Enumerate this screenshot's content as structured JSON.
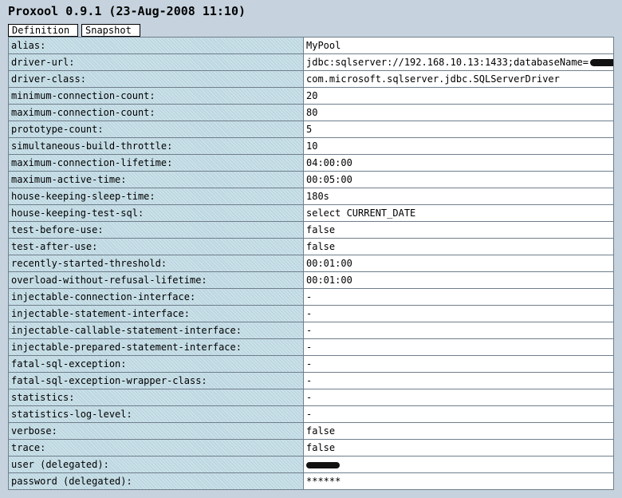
{
  "header": {
    "title": "Proxool 0.9.1 (23-Aug-2008 11:10)"
  },
  "tabs": [
    {
      "label": "Definition"
    },
    {
      "label": "Snapshot"
    }
  ],
  "properties": [
    {
      "name": "alias:",
      "value": "MyPool"
    },
    {
      "name": "driver-url:",
      "value": "jdbc:sqlserver://192.168.10.13:1433;databaseName="
    },
    {
      "name": "driver-class:",
      "value": "com.microsoft.sqlserver.jdbc.SQLServerDriver"
    },
    {
      "name": "minimum-connection-count:",
      "value": "20"
    },
    {
      "name": "maximum-connection-count:",
      "value": "80"
    },
    {
      "name": "prototype-count:",
      "value": "5"
    },
    {
      "name": "simultaneous-build-throttle:",
      "value": "10"
    },
    {
      "name": "maximum-connection-lifetime:",
      "value": "04:00:00"
    },
    {
      "name": "maximum-active-time:",
      "value": "00:05:00"
    },
    {
      "name": "house-keeping-sleep-time:",
      "value": "180s"
    },
    {
      "name": "house-keeping-test-sql:",
      "value": "select CURRENT_DATE"
    },
    {
      "name": "test-before-use:",
      "value": "false"
    },
    {
      "name": "test-after-use:",
      "value": "false"
    },
    {
      "name": "recently-started-threshold:",
      "value": "00:01:00"
    },
    {
      "name": "overload-without-refusal-lifetime:",
      "value": "00:01:00"
    },
    {
      "name": "injectable-connection-interface:",
      "value": "-"
    },
    {
      "name": "injectable-statement-interface:",
      "value": "-"
    },
    {
      "name": "injectable-callable-statement-interface:",
      "value": "-"
    },
    {
      "name": "injectable-prepared-statement-interface:",
      "value": "-"
    },
    {
      "name": "fatal-sql-exception:",
      "value": "-"
    },
    {
      "name": "fatal-sql-exception-wrapper-class:",
      "value": "-"
    },
    {
      "name": "statistics:",
      "value": "-"
    },
    {
      "name": "statistics-log-level:",
      "value": "-"
    },
    {
      "name": "verbose:",
      "value": "false"
    },
    {
      "name": "trace:",
      "value": "false"
    },
    {
      "name": "user (delegated):",
      "value": ""
    },
    {
      "name": "password (delegated):",
      "value": "******"
    }
  ],
  "colors": {
    "page_background": "#c6d3de",
    "name_cell": "#bcd7e1",
    "value_cell": "#ffffff"
  }
}
